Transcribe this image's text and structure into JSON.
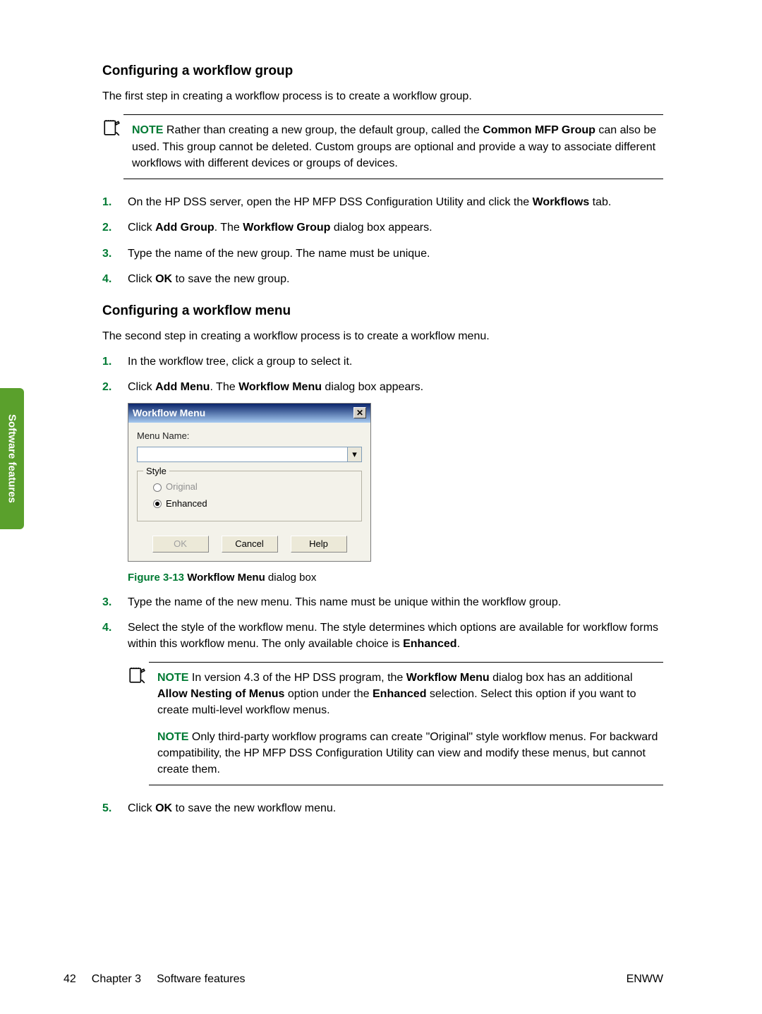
{
  "sideTab": "Software features",
  "section1": {
    "heading": "Configuring a workflow group",
    "intro": "The first step in creating a workflow process is to create a workflow group.",
    "note": {
      "label": "NOTE",
      "text_before": " Rather than creating a new group, the default group, called the ",
      "bold": "Common MFP Group",
      "text_after": " can also be used. This group cannot be deleted. Custom groups are optional and provide a way to associate different workflows with different devices or groups of devices."
    },
    "steps": {
      "s1_a": "On the HP DSS server, open the HP MFP DSS Configuration Utility and click the ",
      "s1_b": "Workflows",
      "s1_c": " tab.",
      "s2_a": "Click ",
      "s2_b": "Add Group",
      "s2_c": ". The ",
      "s2_d": "Workflow Group",
      "s2_e": " dialog box appears.",
      "s3": "Type the name of the new group. The name must be unique.",
      "s4_a": "Click ",
      "s4_b": "OK",
      "s4_c": " to save the new group."
    }
  },
  "section2": {
    "heading": "Configuring a workflow menu",
    "intro": "The second step in creating a workflow process is to create a workflow menu.",
    "steps": {
      "s1": "In the workflow tree, click a group to select it.",
      "s2_a": "Click ",
      "s2_b": "Add Menu",
      "s2_c": ". The ",
      "s2_d": "Workflow Menu",
      "s2_e": " dialog box appears.",
      "s3": "Type the name of the new menu. This name must be unique within the workflow group.",
      "s4_a": "Select the style of the workflow menu. The style determines which options are available for workflow forms within this workflow menu. The only available choice is ",
      "s4_b": "Enhanced",
      "s4_c": ".",
      "s5_a": "Click ",
      "s5_b": "OK",
      "s5_c": " to save the new workflow menu."
    },
    "dialog": {
      "title": "Workflow Menu",
      "menuNameLabel": "Menu Name:",
      "menuNameValue": "",
      "styleLegend": "Style",
      "optOriginal": "Original",
      "optEnhanced": "Enhanced",
      "btnOK": "OK",
      "btnCancel": "Cancel",
      "btnHelp": "Help"
    },
    "figure": {
      "label": "Figure 3-13",
      "bold": "Workflow Menu",
      "rest": " dialog box"
    },
    "note1": {
      "label": "NOTE",
      "a": " In version 4.3 of the HP DSS program, the ",
      "b": "Workflow Menu",
      "c": " dialog box has an additional ",
      "d": "Allow Nesting of Menus",
      "e": " option under the ",
      "f": "Enhanced",
      "g": " selection. Select this option if you want to create multi-level workflow menus."
    },
    "note2": {
      "label": "NOTE",
      "text": " Only third-party workflow programs can create \"Original\" style workflow menus. For backward compatibility, the HP MFP DSS Configuration Utility can view and modify these menus, but cannot create them."
    }
  },
  "footer": {
    "pageNum": "42",
    "chapter": "Chapter 3",
    "chapterTitle": "Software features",
    "right": "ENWW"
  }
}
